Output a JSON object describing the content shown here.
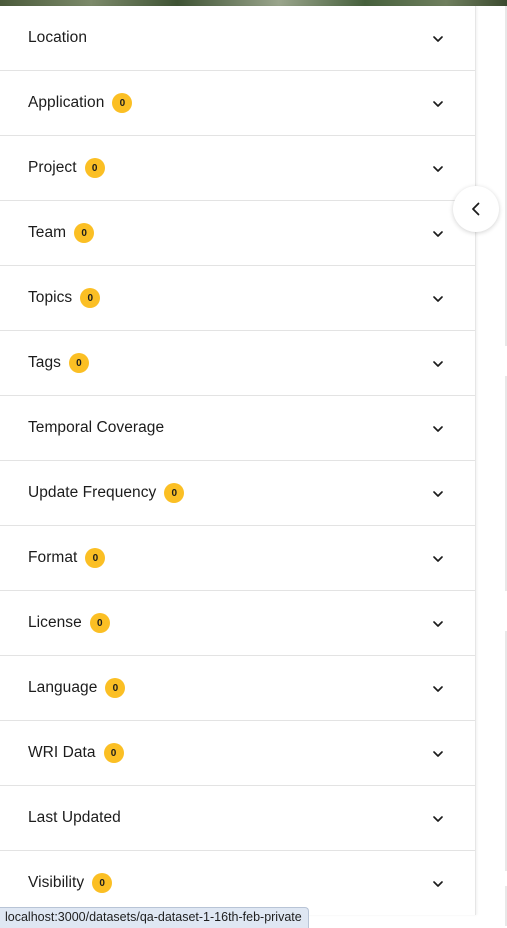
{
  "filters": [
    {
      "label": "Location",
      "badge": null
    },
    {
      "label": "Application",
      "badge": "0"
    },
    {
      "label": "Project",
      "badge": "0"
    },
    {
      "label": "Team",
      "badge": "0"
    },
    {
      "label": "Topics",
      "badge": "0"
    },
    {
      "label": "Tags",
      "badge": "0"
    },
    {
      "label": "Temporal Coverage",
      "badge": null
    },
    {
      "label": "Update Frequency",
      "badge": "0"
    },
    {
      "label": "Format",
      "badge": "0"
    },
    {
      "label": "License",
      "badge": "0"
    },
    {
      "label": "Language",
      "badge": "0"
    },
    {
      "label": "WRI Data",
      "badge": "0"
    },
    {
      "label": "Last Updated",
      "badge": null
    },
    {
      "label": "Visibility",
      "badge": "0"
    }
  ],
  "icons": {
    "row_chevron": "chevron-down-icon",
    "collapse": "chevron-left-icon"
  },
  "colors": {
    "badge": "#fbbf24",
    "divider": "#e3e3e3",
    "text": "#1c1c1c",
    "status_bar": "#dfe7f3"
  },
  "status_bar": {
    "url": "localhost:3000/datasets/qa-dataset-1-16th-feb-private"
  }
}
